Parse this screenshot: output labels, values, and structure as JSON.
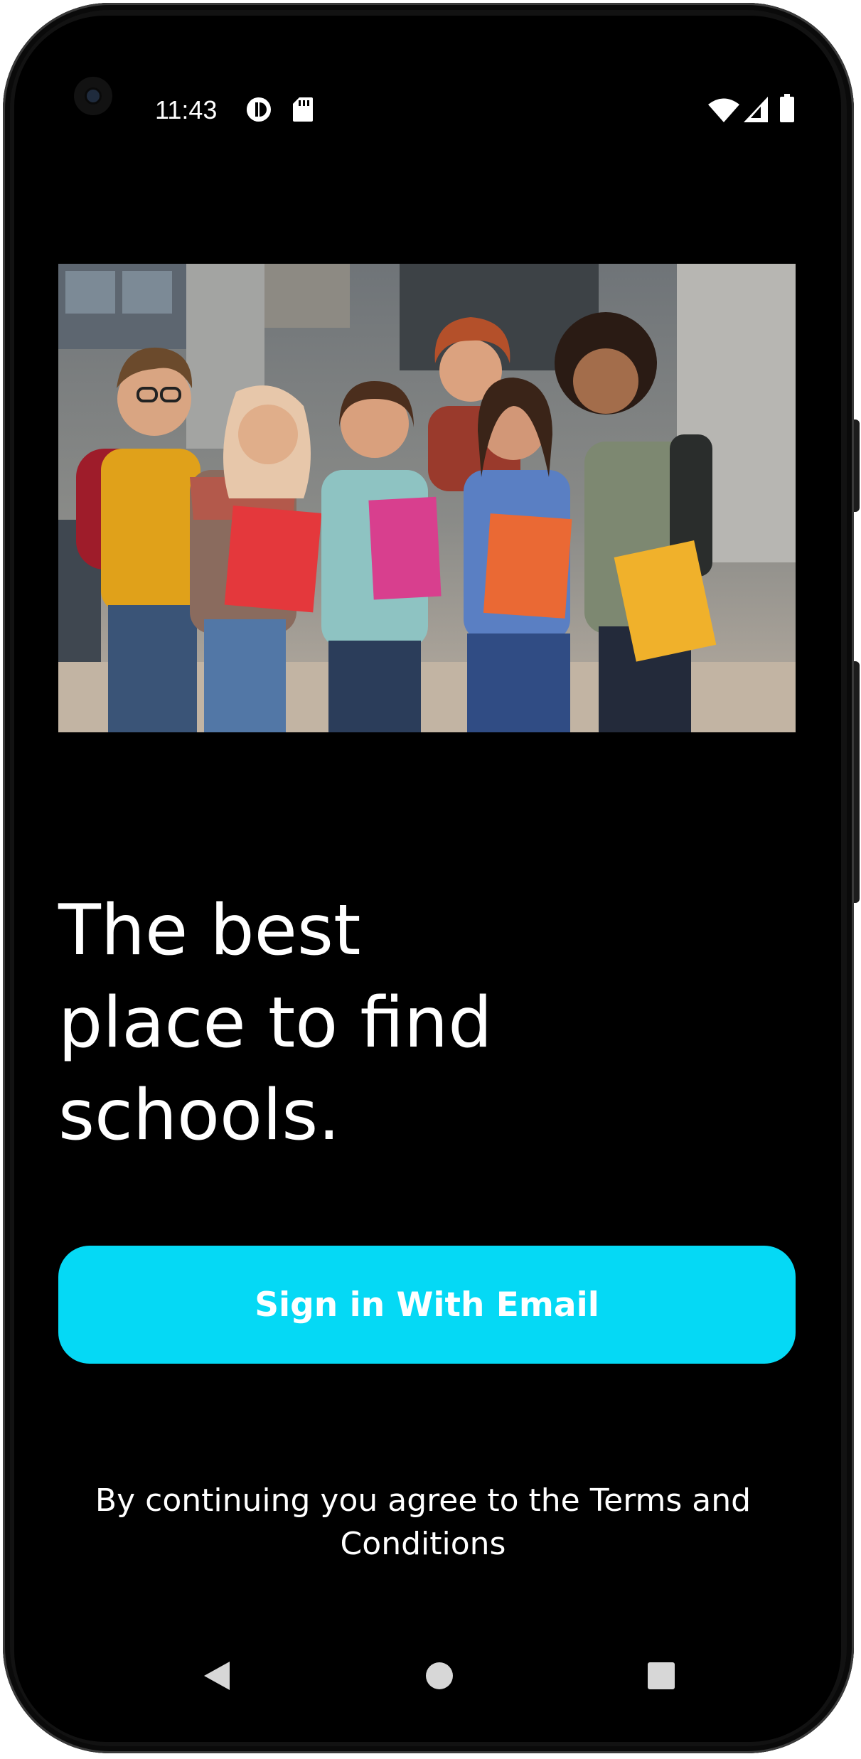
{
  "status_bar": {
    "time": "11:43",
    "icons": [
      "data-saver-icon",
      "sd-card-icon",
      "wifi-icon",
      "cellular-signal-icon",
      "battery-icon"
    ]
  },
  "hero": {
    "image": "group-of-smiling-students-holding-notebooks-photo"
  },
  "headline": {
    "line1": "The best",
    "line2": "place to find",
    "line3": "schools."
  },
  "actions": {
    "signin_label": "Sign in With Email"
  },
  "footer": {
    "terms_text": "By continuing you agree to the Terms and Conditions"
  },
  "nav_bar": {
    "icons": [
      "back-icon",
      "home-icon",
      "recents-icon"
    ]
  },
  "colors": {
    "background": "#000000",
    "accent": "#05d9f5",
    "text": "#ffffff"
  }
}
